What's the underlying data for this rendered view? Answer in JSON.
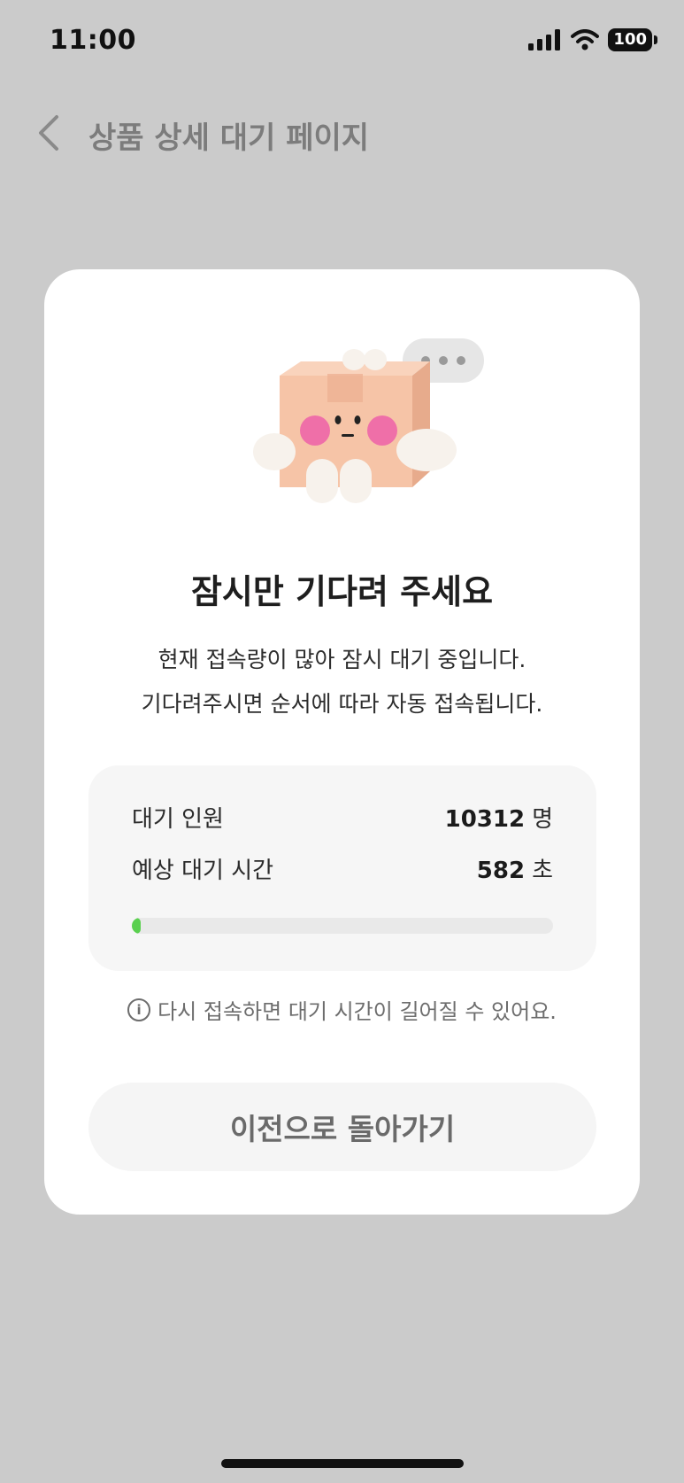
{
  "status_bar": {
    "time": "11:00",
    "battery": "100",
    "icons": [
      "cellular-signal-icon",
      "wifi-icon",
      "battery-icon"
    ]
  },
  "nav": {
    "back_icon": "chevron-left-icon",
    "title": "상품 상세 대기 페이지"
  },
  "modal": {
    "illustration": "box-character-with-speech-bubble",
    "title": "잠시만 기다려 주세요",
    "description_line1": "현재 접속량이 많아 잠시 대기 중입니다.",
    "description_line2": "기다려주시면 순서에 따라 자동 접속됩니다.",
    "queue": {
      "people_label": "대기 인원",
      "people_value": "10312",
      "people_unit": "명",
      "time_label": "예상 대기 시간",
      "time_value": "582",
      "time_unit": "초",
      "progress_percent": 2
    },
    "notice_icon": "info-circle-icon",
    "notice": "다시 접속하면 대기 시간이 길어질 수 있어요.",
    "back_button_label": "이전으로 돌아가기"
  },
  "colors": {
    "background": "#cbcbcb",
    "card": "#ffffff",
    "progress": "#5ad04f",
    "button_bg": "#f5f5f5"
  }
}
